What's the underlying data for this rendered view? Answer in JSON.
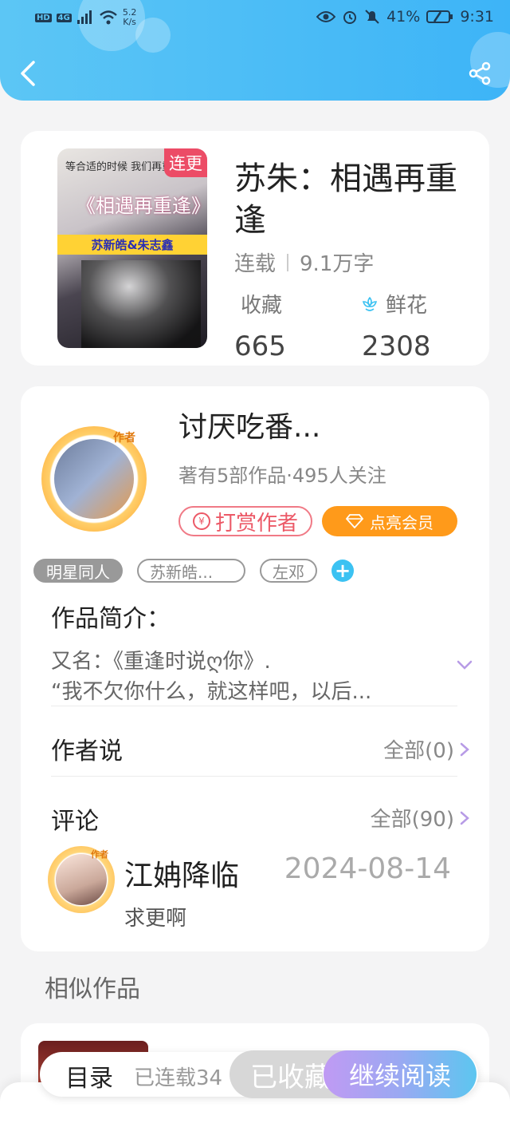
{
  "status_bar": {
    "left_badges": [
      "HD",
      "4G"
    ],
    "speed_value": "5.2",
    "speed_unit": "K/s",
    "battery": "41%",
    "time": "9:31"
  },
  "book": {
    "cover_badge": "连更",
    "cover_line": "等合适的时候 我们再重逢",
    "cover_title": "《相遇再重逢》",
    "cover_names": "苏新皓&朱志鑫",
    "title": "苏朱：相遇再重逢",
    "status": "连载",
    "word_count": "9.1万字",
    "favorites_label": "收藏",
    "favorites_value": "665",
    "flowers_label": "鲜花",
    "flowers_value": "2308"
  },
  "author": {
    "avatar_tag": "作者",
    "name": "讨厌吃番...",
    "subtitle": "著有5部作品·495人关注",
    "tip_coin": "¥",
    "tip_label": "打赏作者",
    "vip_label": "点亮会员"
  },
  "tags": [
    "明星同人",
    "苏新皓...",
    "左邓"
  ],
  "tag_add": "+",
  "synopsis": {
    "title": "作品简介：",
    "line1": "又名：《重逢时说ღ你》.",
    "line2": "“我不欠你什么，就这样吧，以后..."
  },
  "author_says": {
    "title": "作者说",
    "link": "全部(0)"
  },
  "comments": {
    "title": "评论",
    "link": "全部(90)",
    "items": [
      {
        "avatar_tag": "作者",
        "name": "江姌降临",
        "date": "2024-08-14",
        "text": "求更啊"
      }
    ]
  },
  "similar": {
    "title": "相似作品"
  },
  "bottom_bar": {
    "toc_label": "目录",
    "toc_progress": "已连载34",
    "collected_label": "已收藏",
    "read_label": "继续阅读"
  },
  "colors": {
    "header": "#3db4f7",
    "tip": "#ec5967",
    "vip": "#ff9a1a",
    "accent_tag": "#3cc2f2"
  }
}
